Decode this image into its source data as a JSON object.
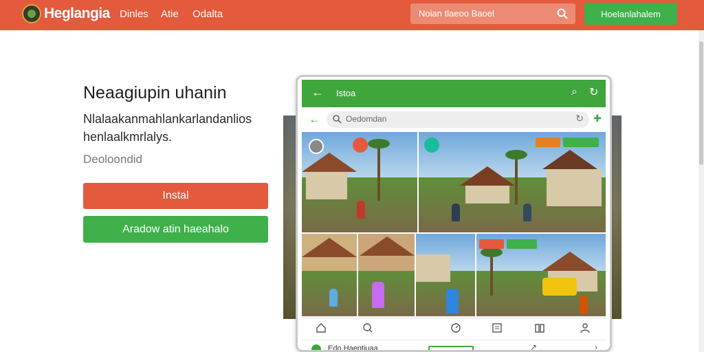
{
  "header": {
    "brand": "Heglangia",
    "nav": [
      "Dinles",
      "Atie",
      "Odalta"
    ],
    "search_placeholder": "Noian tlaeoo Baoel",
    "cta_label": "Hoelanlahalem"
  },
  "hero": {
    "title": "Neaagiupin uhanin",
    "description": "Nlalaakanmahlankarlandanlios henlaalkmrlalys.",
    "subnote": "Deoloondid",
    "install_label": "Instal",
    "secondary_label": "Aradow atin haeahalo"
  },
  "tablet": {
    "app_title": "Istoa",
    "search_text": "Oedomdan",
    "footer_text": "Edo Haeptiuaa"
  },
  "colors": {
    "accent_red": "#e45a3c",
    "accent_green": "#3fb04a"
  },
  "icons": [
    "logo",
    "search-icon",
    "back-arrow-icon",
    "refresh-icon",
    "home-icon",
    "search-icon",
    "compass-icon",
    "list-icon",
    "book-icon",
    "user-icon"
  ]
}
